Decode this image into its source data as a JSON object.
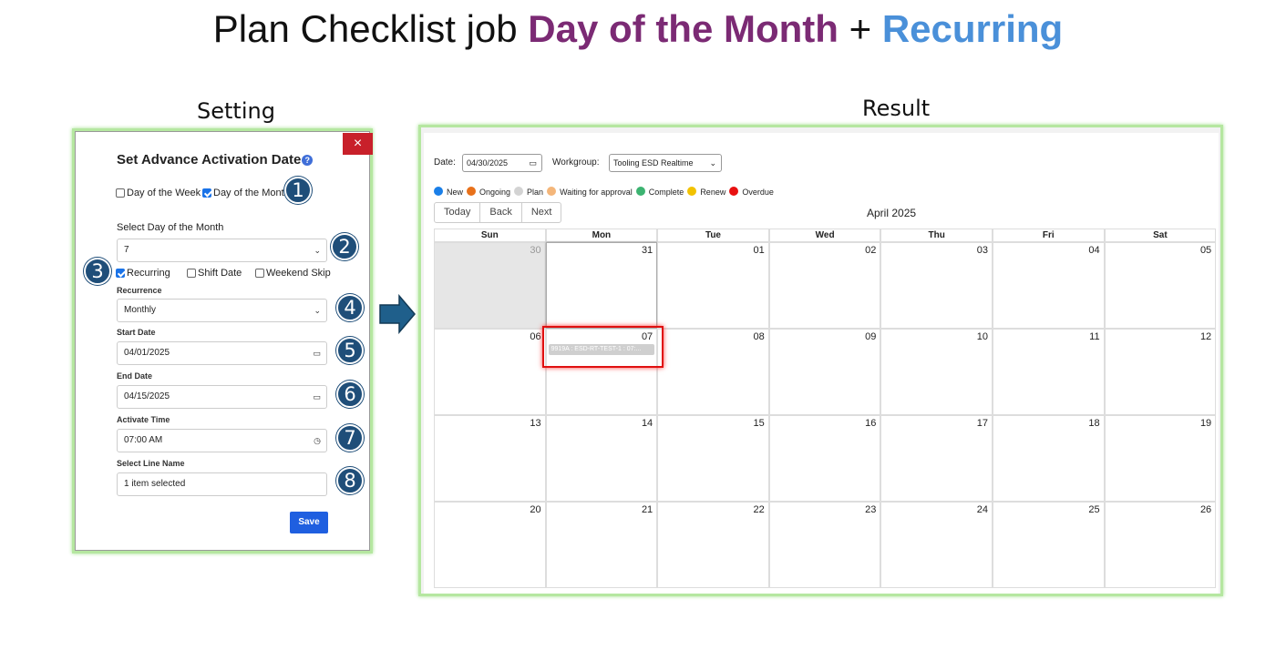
{
  "title": {
    "prefix": "Plan Checklist job ",
    "highlight1": "Day of the Month",
    "joiner": " + ",
    "highlight2": "Recurring"
  },
  "labels": {
    "setting": "Setting",
    "result": "Result"
  },
  "modal": {
    "close_icon": "×",
    "title": "Set Advance Activation Date",
    "help_icon": "?",
    "mode_options": [
      {
        "label": "Day of the Week",
        "checked": false
      },
      {
        "label": "Day of the Month",
        "checked": true
      }
    ],
    "day_label": "Select Day of the Month",
    "day_value": "7",
    "options": [
      {
        "label": "Recurring",
        "checked": true
      },
      {
        "label": "Shift Date",
        "checked": false
      },
      {
        "label": "Weekend Skip",
        "checked": false
      }
    ],
    "recurrence_label": "Recurrence",
    "recurrence_value": "Monthly",
    "start_label": "Start Date",
    "start_value": "04/01/2025",
    "end_label": "End Date",
    "end_value": "04/15/2025",
    "time_label": "Activate Time",
    "time_value": "07:00 AM",
    "line_label": "Select Line Name",
    "line_value": "1 item selected",
    "save_label": "Save"
  },
  "badges": [
    "1",
    "2",
    "3",
    "4",
    "5",
    "6",
    "7",
    "8"
  ],
  "calendar_view": {
    "date_label": "Date:",
    "date_value": "04/30/2025",
    "workgroup_label": "Workgroup:",
    "workgroup_value": "Tooling ESD Realtime",
    "legend": [
      {
        "label": "New",
        "color": "#1a7fe8"
      },
      {
        "label": "Ongoing",
        "color": "#e8711a"
      },
      {
        "label": "Plan",
        "color": "#d3d3d3"
      },
      {
        "label": "Waiting for approval",
        "color": "#f4b67a"
      },
      {
        "label": "Complete",
        "color": "#3cb371"
      },
      {
        "label": "Renew",
        "color": "#f2c200"
      },
      {
        "label": "Overdue",
        "color": "#e81010"
      }
    ],
    "nav": [
      "Today",
      "Back",
      "Next"
    ],
    "month": "April 2025",
    "weekdays": [
      "Sun",
      "Mon",
      "Tue",
      "Wed",
      "Thu",
      "Fri",
      "Sat"
    ],
    "weeks": [
      [
        "30",
        "31",
        "01",
        "02",
        "03",
        "04",
        "05"
      ],
      [
        "06",
        "07",
        "08",
        "09",
        "10",
        "11",
        "12"
      ],
      [
        "13",
        "14",
        "15",
        "16",
        "17",
        "18",
        "19"
      ],
      [
        "20",
        "21",
        "22",
        "23",
        "24",
        "25",
        "26"
      ]
    ],
    "event_text": "9919A : ESD-RT-TEST-1 : 07:..."
  }
}
